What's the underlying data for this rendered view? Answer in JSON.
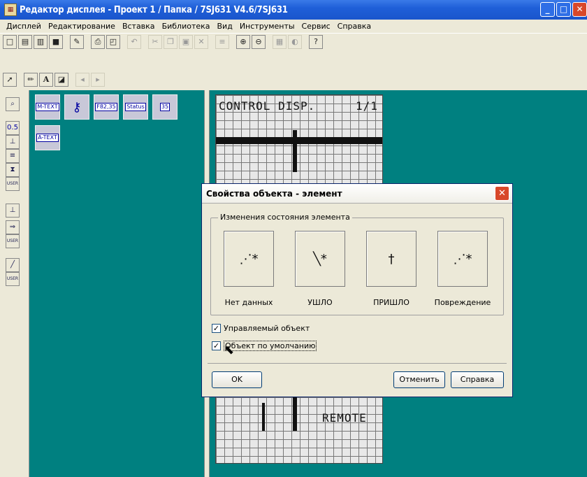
{
  "window": {
    "title": "Редактор дисплея - Проект 1 / Папка / 7SJ631 V4.6/7SJ631",
    "app_icon": "display-editor-icon"
  },
  "menu": [
    "Дисплей",
    "Редактирование",
    "Вставка",
    "Библиотека",
    "Вид",
    "Инструменты",
    "Сервис",
    "Справка"
  ],
  "palette": {
    "items": [
      "M-TEXT",
      "key",
      "F82,35",
      "Status",
      "35",
      "A-TEXT"
    ]
  },
  "left_tools": {
    "scale_label": "0.5",
    "user_label": "USER"
  },
  "lcd": {
    "header": "CONTROL DISP.",
    "page": "1/1",
    "remote": "REMOTE"
  },
  "dialog": {
    "title": "Свойства объекта - элемент",
    "group_label": "Изменения состояния элемента",
    "states": [
      "Нет данных",
      "УШЛО",
      "ПРИШЛО",
      "Повреждение"
    ],
    "checkboxes": [
      {
        "label": "Управляемый объект",
        "checked": true
      },
      {
        "label": "Объект по умолчанию",
        "checked": true
      }
    ],
    "buttons": {
      "ok": "OK",
      "cancel": "Отменить",
      "help": "Справка"
    }
  },
  "colors": {
    "teal": "#008080",
    "titlebar": "#1f5fd8",
    "dialog_bg": "#ece9d8"
  }
}
